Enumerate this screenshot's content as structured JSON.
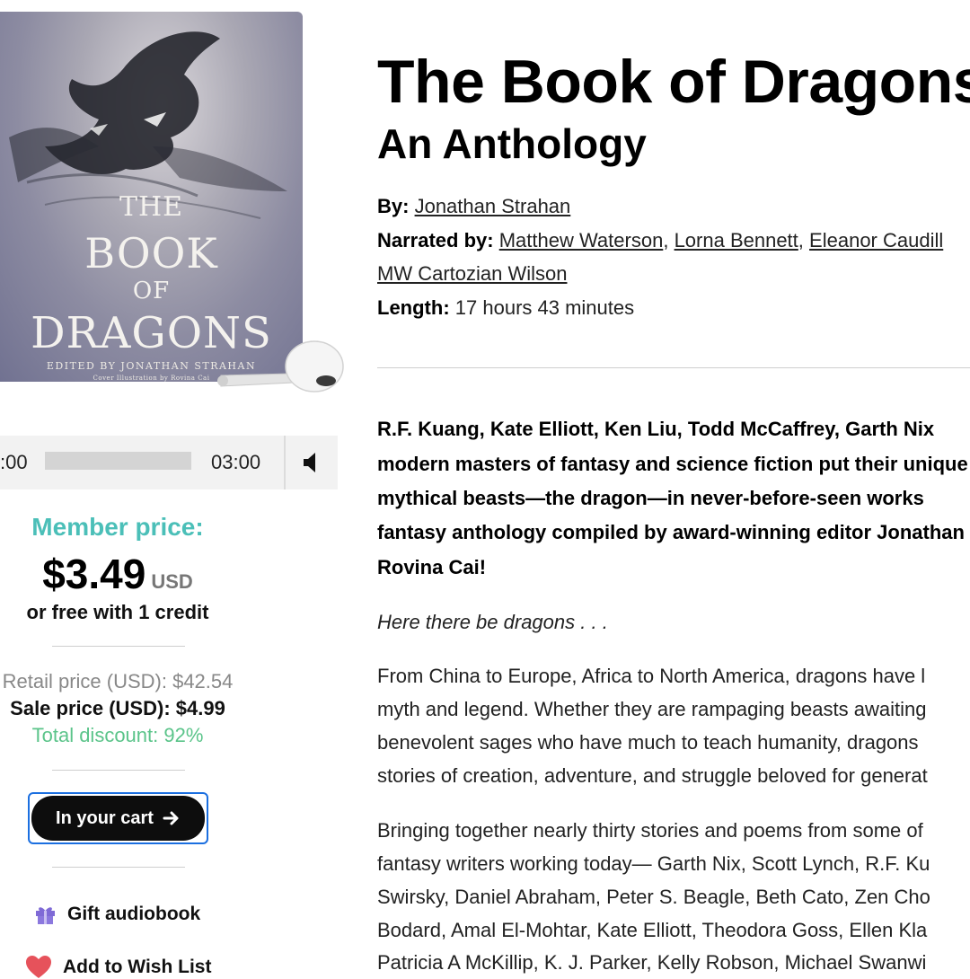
{
  "cover": {
    "title_the": "THE",
    "title_book": "BOOK",
    "title_of": "OF",
    "title_dragons": "DRAGONS",
    "edited_by": "EDITED BY JONATHAN STRAHAN",
    "illustration": "Cover Illustration by Rovina Cai"
  },
  "player": {
    "time_left": ":00",
    "time_right": "03:00",
    "progress": 0.0,
    "volume_icon": "speaker-icon"
  },
  "pricing": {
    "member_label": "Member price:",
    "member_price": "$3.49",
    "currency": "USD",
    "free_credit": "or free with 1 credit",
    "retail": "Retail price (USD): $42.54",
    "sale": "Sale price (USD): $4.99",
    "discount": "Total discount: 92%",
    "colors": {
      "member": "#4bbfb8",
      "discount": "#5bc48a",
      "cart_border": "#1b6fe0"
    }
  },
  "actions": {
    "cart_label": "In your cart",
    "gift_label": "Gift audiobook",
    "wish_label": "Add to Wish List"
  },
  "book": {
    "title": "The Book of Dragons",
    "subtitle": "An Anthology",
    "by_label": "By:",
    "author": "Jonathan Strahan",
    "narrated_label": "Narrated by:",
    "narrators": [
      "Matthew Waterson",
      "Lorna Bennett",
      "Eleanor Caudill",
      "MW Cartozian Wilson"
    ],
    "sep": ",",
    "length_label": "Length:",
    "length": "17 hours 43 minutes"
  },
  "description": {
    "bold_lines": [
      "R.F. Kuang, Kate Elliott, Ken Liu, Todd McCaffrey, Garth Nix",
      "modern masters of fantasy and science fiction put their unique",
      "mythical beasts—the dragon—in never-before-seen works",
      "fantasy anthology compiled by award-winning editor Jonathan",
      "Rovina Cai!"
    ],
    "italic": "Here there be dragons . . .",
    "para2": [
      "From China to Europe, Africa to North America, dragons have l",
      "myth and legend. Whether they are rampaging beasts awaiting",
      "benevolent sages who have much to teach humanity, dragons",
      "stories of creation, adventure, and struggle beloved for generat"
    ],
    "para3": [
      "Bringing together nearly thirty stories and poems from some of",
      "fantasy writers working today— Garth Nix, Scott Lynch, R.F. Ku",
      "Swirsky, Daniel Abraham, Peter S. Beagle, Beth Cato, Zen Cho",
      "Bodard, Amal El-Mohtar, Kate Elliott, Theodora Goss, Ellen Kla",
      "Patricia A McKillip, K. J. Parker, Kelly Robson, Michael Swanwi"
    ]
  }
}
